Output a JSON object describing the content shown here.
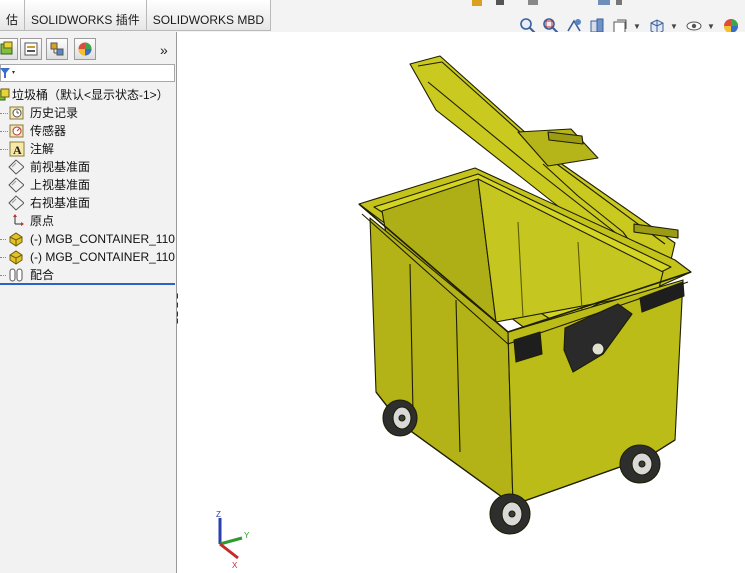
{
  "tabs": [
    "估",
    "SOLIDWORKS 插件",
    "SOLIDWORKS MBD"
  ],
  "feature_tree": {
    "items": [
      {
        "label": "垃圾桶（默认<显示状态-1>）",
        "icon": "assembly-icon"
      },
      {
        "label": "历史记录",
        "icon": "history-icon"
      },
      {
        "label": "传感器",
        "icon": "sensor-icon"
      },
      {
        "label": "注解",
        "icon": "annotation-icon"
      },
      {
        "label": "前视基准面",
        "icon": "plane-icon"
      },
      {
        "label": "上视基准面",
        "icon": "plane-icon"
      },
      {
        "label": "右视基准面",
        "icon": "plane-icon"
      },
      {
        "label": "原点",
        "icon": "origin-icon"
      },
      {
        "label": "(-) MGB_CONTAINER_110",
        "icon": "part-icon"
      },
      {
        "label": "(-) MGB_CONTAINER_110",
        "icon": "part-icon"
      },
      {
        "label": "配合",
        "icon": "mates-icon"
      }
    ]
  },
  "model": {
    "body_color": "#b5b51a",
    "edge_color": "#1e1e00",
    "wheel_color": "#3b3b3b"
  },
  "triad": {
    "x_label": "X",
    "y_label": "Y",
    "z_label": "Z"
  }
}
